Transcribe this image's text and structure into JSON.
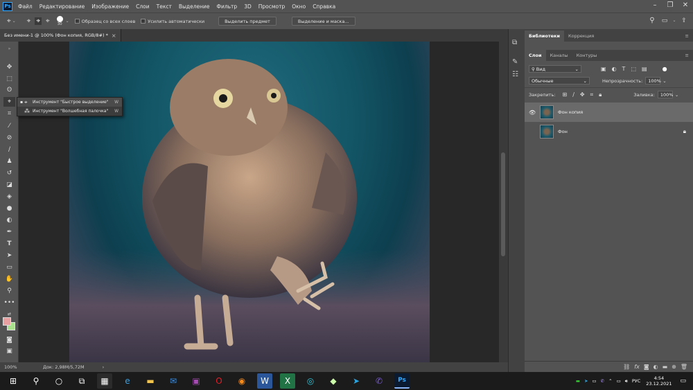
{
  "menu": {
    "logo": "Ps",
    "items": [
      "Файл",
      "Редактирование",
      "Изображение",
      "Слои",
      "Текст",
      "Выделение",
      "Фильтр",
      "3D",
      "Просмотр",
      "Окно",
      "Справка"
    ]
  },
  "options": {
    "brush_size": "30",
    "sample_all_layers": "Образец со всех слоев",
    "auto_enhance": "Усилить автоматически",
    "select_subject": "Выделить предмет",
    "select_and_mask": "Выделение и маска..."
  },
  "document": {
    "tab_title": "Без имени-1 @ 100% (Фон копия, RGB/8#) *",
    "close": "×"
  },
  "status": {
    "zoom": "100%",
    "doc_size": "Док: 2,98M/5,72M",
    "arrow": "›"
  },
  "flyout": {
    "items": [
      {
        "label": "Инструмент \"Быстрое выделение\"",
        "key": "W"
      },
      {
        "label": "Инструмент \"Волшебная палочка\"",
        "key": "W"
      }
    ]
  },
  "panels": {
    "top_tabs": [
      "Библиотеки",
      "Коррекция"
    ],
    "layer_tabs": [
      "Слои",
      "Каналы",
      "Контуры"
    ],
    "filter_kind": "Вид",
    "blend_mode": "Обычные",
    "opacity_label": "Непрозрачность:",
    "opacity_value": "100%",
    "lock_label": "Закрепить:",
    "fill_label": "Заливка:",
    "fill_value": "100%",
    "layers": [
      {
        "name": "Фон копия",
        "visible": true,
        "locked": false,
        "selected": true
      },
      {
        "name": "Фон",
        "visible": false,
        "locked": true,
        "selected": false
      }
    ]
  },
  "taskbar": {
    "lang": "РУС",
    "time": "4:54",
    "date": "23.12.2021"
  },
  "colors": {
    "foreground": "#e8a0a0",
    "background": "#a8e08c",
    "accent": "#31a8ff"
  }
}
